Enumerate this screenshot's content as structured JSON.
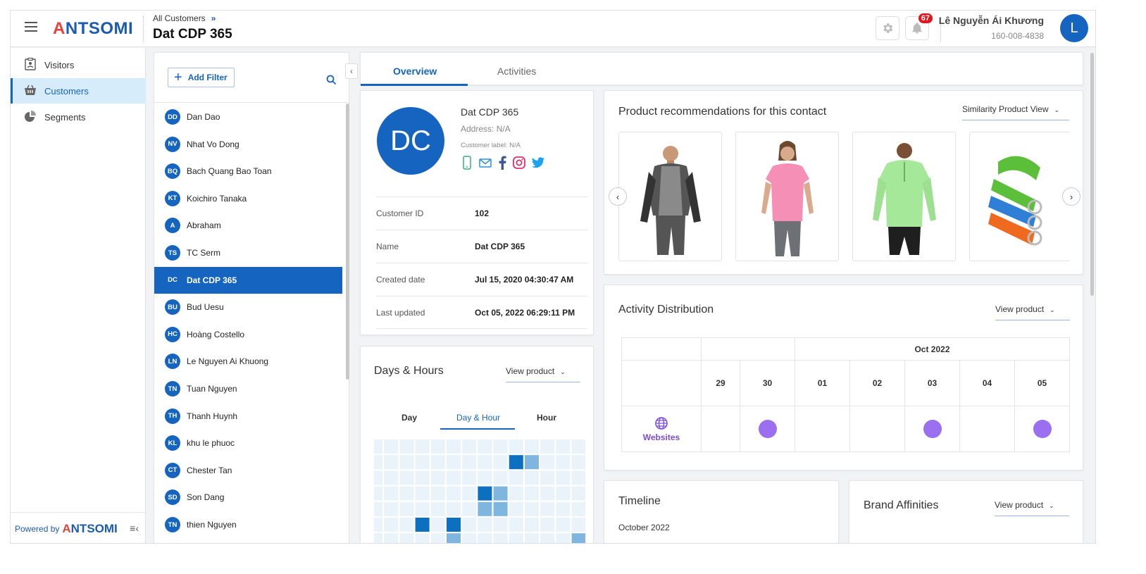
{
  "header": {
    "logo": "ANTSOMI",
    "breadcrumb": "All Customers",
    "breadcrumb_sep": "»",
    "title": "Dat CDP 365",
    "notif_count": "67",
    "user_name": "Lê Nguyễn Ái Khương",
    "user_phone": "160-008-4838",
    "avatar_letter": "L"
  },
  "sidebar": {
    "items": [
      {
        "label": "Visitors",
        "icon": "clipboard-user-icon"
      },
      {
        "label": "Customers",
        "icon": "basket-icon"
      },
      {
        "label": "Segments",
        "icon": "pie-chart-icon"
      }
    ],
    "powered_by": "Powered by",
    "powered_logo": "ANTSOMI"
  },
  "list": {
    "add_filter": "Add Filter",
    "customers": [
      {
        "ini": "DD",
        "name": "Dan Dao"
      },
      {
        "ini": "NV",
        "name": "Nhat Vo Dong"
      },
      {
        "ini": "BQ",
        "name": "Bach Quang Bao Toan"
      },
      {
        "ini": "KT",
        "name": "Koichiro Tanaka"
      },
      {
        "ini": "A",
        "name": "Abraham"
      },
      {
        "ini": "TS",
        "name": "TC Serm"
      },
      {
        "ini": "DC",
        "name": "Dat CDP 365"
      },
      {
        "ini": "BU",
        "name": "Bud Uesu"
      },
      {
        "ini": "HC",
        "name": "Hoàng Costello"
      },
      {
        "ini": "LN",
        "name": "Le Nguyen Ai Khuong"
      },
      {
        "ini": "TN",
        "name": "Tuan Nguyen"
      },
      {
        "ini": "TH",
        "name": "Thanh Huynh"
      },
      {
        "ini": "KL",
        "name": "khu le phuoc"
      },
      {
        "ini": "CT",
        "name": "Chester Tan"
      },
      {
        "ini": "SD",
        "name": "Son Dang"
      },
      {
        "ini": "TN",
        "name": "thien Nguyen"
      }
    ],
    "selected_index": 6
  },
  "tabs": {
    "overview": "Overview",
    "activities": "Activities"
  },
  "profile": {
    "initials": "DC",
    "name": "Dat CDP 365",
    "address": "Address: N/A",
    "label": "Customer label: N/A",
    "fields": [
      {
        "k": "Customer ID",
        "v": "102"
      },
      {
        "k": "Name",
        "v": "Dat CDP 365"
      },
      {
        "k": "Created date",
        "v": "Jul 15, 2020 04:30:47 AM"
      },
      {
        "k": "Last updated",
        "v": "Oct 05, 2022 06:29:11 PM"
      }
    ]
  },
  "days": {
    "title": "Days & Hours",
    "dropdown": "View product",
    "tabs": [
      "Day",
      "Day & Hour",
      "Hour"
    ]
  },
  "recs": {
    "title": "Product recommendations for this contact",
    "dropdown": "Similarity Product View",
    "products": [
      "jacket-image",
      "pink-tee-image",
      "green-pullover-image",
      "yoga-strap-image"
    ]
  },
  "activity": {
    "title": "Activity Distribution",
    "dropdown": "View product",
    "month": "Oct 2022",
    "days": [
      "29",
      "30",
      "01",
      "02",
      "03",
      "04",
      "05"
    ],
    "row_label": "Websites",
    "active": [
      false,
      true,
      false,
      false,
      true,
      false,
      true
    ]
  },
  "timeline": {
    "title": "Timeline",
    "month": "October 2022"
  },
  "brand": {
    "title": "Brand Affinities",
    "dropdown": "View product"
  },
  "colors": {
    "primary": "#1565c0",
    "accent": "#9a6ff0",
    "badge": "#e8121a"
  }
}
